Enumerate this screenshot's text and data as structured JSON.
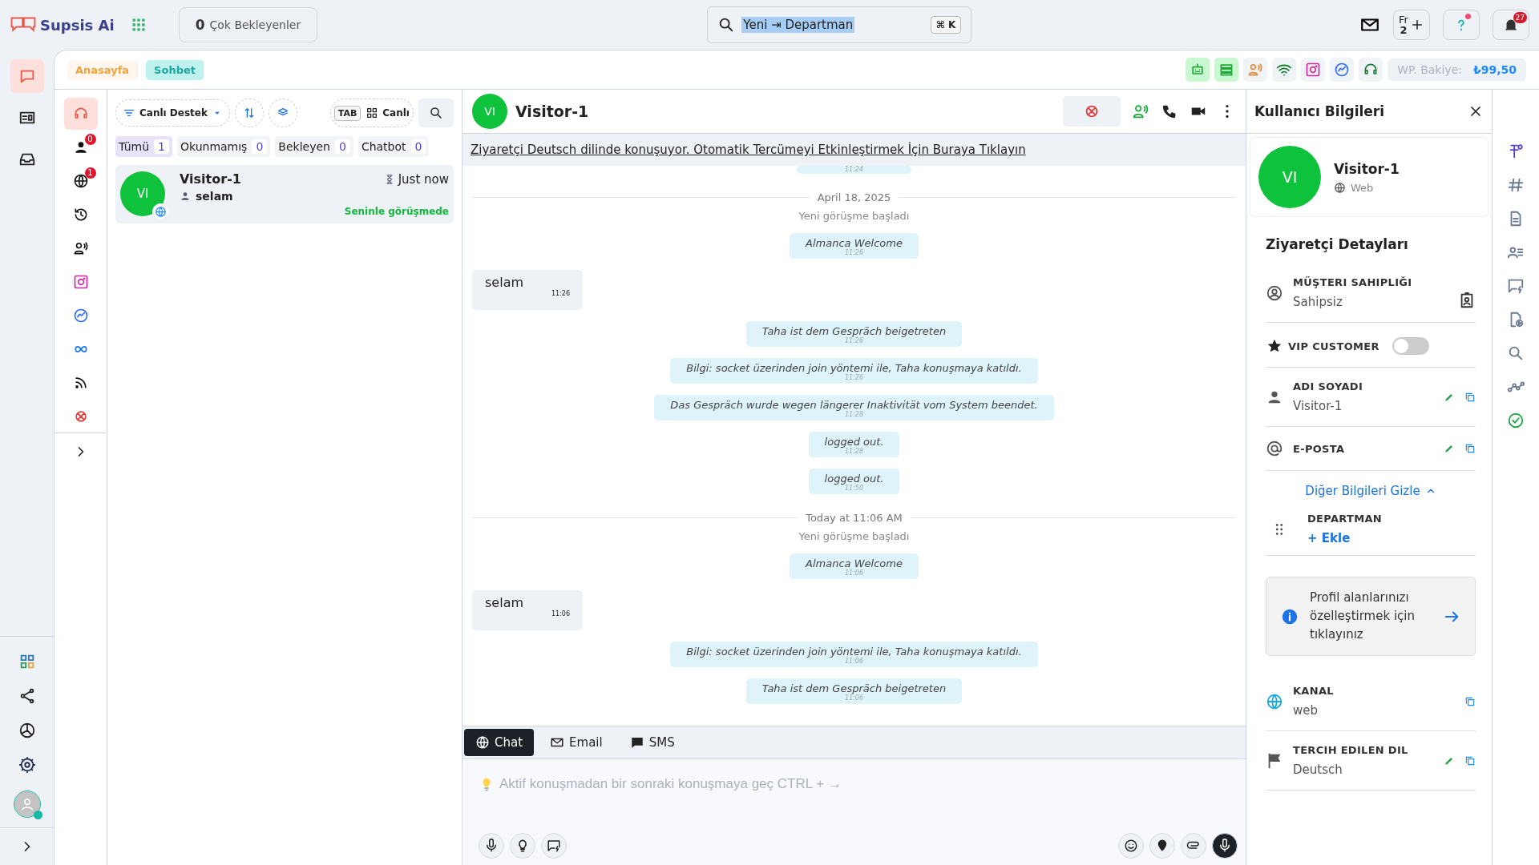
{
  "topbar": {
    "brand": "Supsis Ai",
    "waiting": {
      "count": "0",
      "label": "Çok Bekleyenler"
    },
    "search": {
      "value": "Yeni ⇥ Departman",
      "shortcut": "⌘ K"
    },
    "language": {
      "code": "Fr",
      "number": "2"
    },
    "notifications": "27"
  },
  "main_rail": [
    {
      "selected": true
    },
    {
      "selected": false
    },
    {
      "selected": false
    }
  ],
  "tabs": [
    {
      "label": "Anasayfa",
      "kind": "home",
      "selected": false
    },
    {
      "label": "Sohbet",
      "kind": "chat",
      "selected": true
    }
  ],
  "balance": {
    "label": "WP. Bakiye:",
    "value": "₺99,50"
  },
  "channel_rail": [
    {
      "selected": true
    },
    {
      "badge": "0",
      "selected": false
    },
    {
      "badge": "1",
      "selected": false
    },
    {
      "selected": false
    },
    {
      "selected": false
    },
    {
      "selected": false
    },
    {
      "selected": false
    },
    {
      "selected": false
    },
    {
      "selected": false
    },
    {
      "selected": false
    }
  ],
  "list_toolbar": {
    "filter": "Canlı Destek",
    "tab_key": "TAB",
    "view": "Canlı"
  },
  "filters": [
    {
      "label": "Tümü",
      "count": "1",
      "selected": true
    },
    {
      "label": "Okunmamış",
      "count": "0",
      "selected": false
    },
    {
      "label": "Bekleyen",
      "count": "0",
      "selected": false
    },
    {
      "label": "Chatbot",
      "count": "0",
      "selected": false
    }
  ],
  "conversations": [
    {
      "initials": "VI",
      "name": "Visitor-1",
      "time": "Just now",
      "preview": "selam",
      "status": "Seninle görüşmede",
      "selected": true
    }
  ],
  "chat": {
    "initials": "VI",
    "name": "Visitor-1",
    "banner": "Ziyaretçi Deutsch dilinde konuşuyor. Otomatik Tercümeyi Etkinleştirmek İçin Buraya Tıklayın",
    "messages": [
      {
        "kind": "system",
        "time": "11:24"
      },
      {
        "kind": "date",
        "text": "April 18, 2025"
      },
      {
        "kind": "note",
        "text": "Yeni görüşme başladı"
      },
      {
        "kind": "system",
        "text": "Almanca Welcome",
        "time": "11:26"
      },
      {
        "kind": "visitor",
        "text": "selam",
        "time": "11:26"
      },
      {
        "kind": "system",
        "text": "Taha ist dem Gespräch beigetreten",
        "time": "11:26"
      },
      {
        "kind": "system",
        "text": "Bilgi: socket üzerinden join yöntemi ile, Taha konuşmaya katıldı.",
        "time": "11:26"
      },
      {
        "kind": "system",
        "text": "Das Gespräch wurde wegen längerer Inaktivität vom System beendet.",
        "time": "11:28"
      },
      {
        "kind": "system",
        "text": "logged out.",
        "time": "11:28"
      },
      {
        "kind": "system",
        "text": "logged out.",
        "time": "11:50"
      },
      {
        "kind": "date",
        "text": "Today at 11:06 AM"
      },
      {
        "kind": "note",
        "text": "Yeni görüşme başladı"
      },
      {
        "kind": "system",
        "text": "Almanca Welcome",
        "time": "11:06"
      },
      {
        "kind": "visitor",
        "text": "selam",
        "time": "11:06"
      },
      {
        "kind": "system",
        "text": "Bilgi: socket üzerinden join yöntemi ile, Taha konuşmaya katıldı.",
        "time": "11:06"
      },
      {
        "kind": "system",
        "text": "Taha ist dem Gespräch beigetreten",
        "time": "11:06"
      }
    ],
    "compose_tabs": [
      {
        "label": "Chat",
        "selected": true
      },
      {
        "label": "Email",
        "selected": false
      },
      {
        "label": "SMS",
        "selected": false
      }
    ],
    "placeholder": "Aktif konuşmadan bir sonraki konuşmaya geç CTRL + →"
  },
  "user_panel": {
    "title": "Kullanıcı Bilgileri",
    "initials": "VI",
    "name": "Visitor-1",
    "channel": "Web",
    "section": "Ziyaretçi Detayları",
    "fields": [
      {
        "kind": "owner",
        "label": "MÜŞTERI SAHIPLIĞI",
        "value": "Sahipsiz"
      },
      {
        "kind": "toggle",
        "label": "VIP CUSTOMER",
        "on": false
      },
      {
        "kind": "field",
        "label": "ADI SOYADI",
        "value": "Visitor-1",
        "editable": true
      },
      {
        "kind": "field",
        "label": "E-POSTA",
        "editable": true
      },
      {
        "kind": "link",
        "label": "Diğer Bilgileri Gizle",
        "expanded": true
      },
      {
        "kind": "add",
        "label": "DEPARTMAN",
        "action": "+ Ekle"
      },
      {
        "kind": "info",
        "text": "Profil alanlarınızı özelleştirmek için tıklayınız"
      },
      {
        "kind": "field",
        "label": "KANAL",
        "value": "web",
        "editable": false
      },
      {
        "kind": "field",
        "label": "TERCIH EDILEN DIL",
        "value": "Deutsch",
        "editable": true
      }
    ]
  }
}
